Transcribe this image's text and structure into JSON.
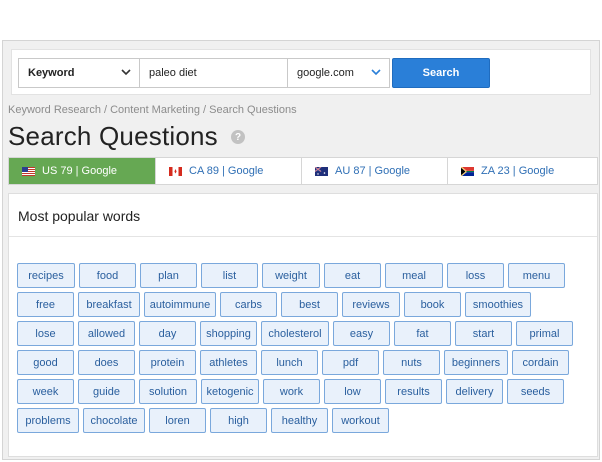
{
  "search": {
    "type_label": "Keyword",
    "term": "paleo diet",
    "engine": "google.com",
    "button_label": "Search"
  },
  "breadcrumb": "Keyword Research / Content Marketing / Search Questions",
  "page_title": "Search Questions",
  "help_symbol": "?",
  "tabs": [
    {
      "label": "US 79 | Google",
      "flag": "us-flag",
      "active": true
    },
    {
      "label": "CA 89 | Google",
      "flag": "ca-flag",
      "active": false
    },
    {
      "label": "AU 87 | Google",
      "flag": "au-flag",
      "active": false
    },
    {
      "label": "ZA 23 | Google",
      "flag": "za-flag",
      "active": false
    }
  ],
  "panel": {
    "title": "Most popular words",
    "rows": [
      [
        "recipes",
        "food",
        "plan",
        "list",
        "weight",
        "eat",
        "meal",
        "loss",
        "menu"
      ],
      [
        "free",
        "breakfast",
        "autoimmune",
        "carbs",
        "best",
        "reviews",
        "book",
        "smoothies"
      ],
      [
        "lose",
        "allowed",
        "day",
        "shopping",
        "cholesterol",
        "easy",
        "fat",
        "start",
        "primal"
      ],
      [
        "good",
        "does",
        "protein",
        "athletes",
        "lunch",
        "pdf",
        "nuts",
        "beginners",
        "cordain"
      ],
      [
        "week",
        "guide",
        "solution",
        "ketogenic",
        "work",
        "low",
        "results",
        "delivery",
        "seeds"
      ],
      [
        "problems",
        "chocolate",
        "loren",
        "high",
        "healthy",
        "workout"
      ]
    ]
  },
  "colors": {
    "active_tab": "#66a853",
    "search_button": "#2a7fd8",
    "chip_border": "#7aa8dc",
    "chip_fill": "#e9f1fb",
    "link": "#2f6fb5"
  }
}
